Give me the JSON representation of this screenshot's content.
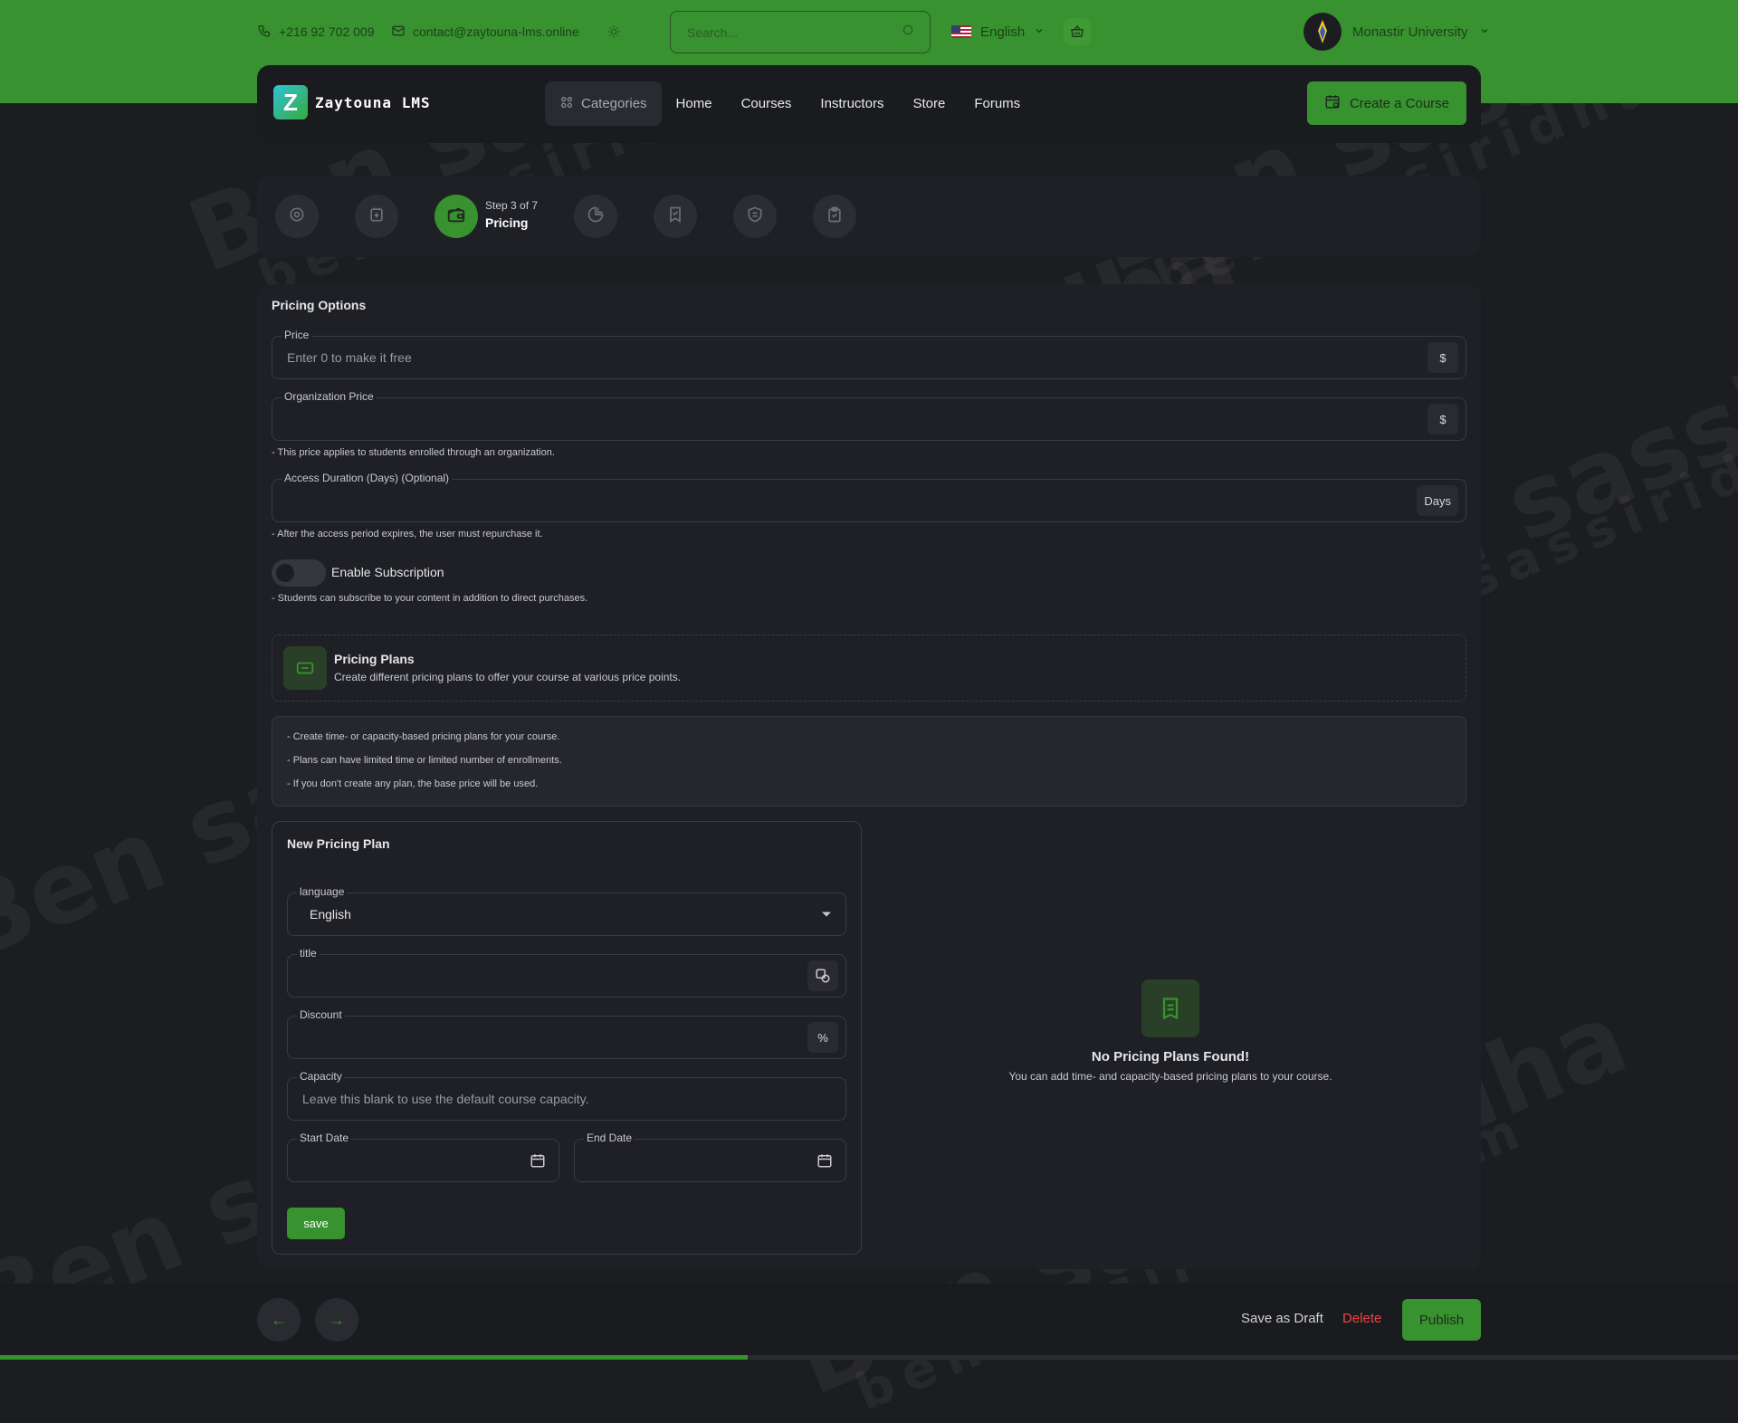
{
  "topbar": {
    "phone": "+216 92 702 009",
    "email": "contact@zaytouna-lms.online",
    "search_placeholder": "Search...",
    "language": "English",
    "user_name": "Monastir University"
  },
  "brand": {
    "logo_letter": "Z",
    "name": "Zaytouna LMS"
  },
  "nav": {
    "categories": "Categories",
    "items": [
      "Home",
      "Courses",
      "Instructors",
      "Store",
      "Forums"
    ],
    "create_button": "Create a Course"
  },
  "steps": {
    "current_label": "Step 3 of 7",
    "current_name": "Pricing",
    "current": 3,
    "total": 7
  },
  "pricing": {
    "section_title": "Pricing Options",
    "price_label": "Price",
    "price_placeholder": "Enter 0 to make it free",
    "price_suffix": "$",
    "org_price_label": "Organization Price",
    "org_price_suffix": "$",
    "org_hint": "- This price applies to students enrolled through an organization.",
    "access_label": "Access Duration (Days) (Optional)",
    "access_suffix": "Days",
    "access_hint": "- After the access period expires, the user must repurchase it.",
    "subscription_label": "Enable Subscription",
    "subscription_enabled": false,
    "subscription_hint": "- Students can subscribe to your content in addition to direct purchases."
  },
  "plans": {
    "title": "Pricing Plans",
    "subtitle": "Create different pricing plans to offer your course at various price points.",
    "info": [
      "- Create time- or capacity-based pricing plans for your course.",
      "- Plans can have limited time or limited number of enrollments.",
      "- If you don't create any plan, the base price will be used."
    ]
  },
  "new_plan": {
    "title": "New Pricing Plan",
    "language_label": "language",
    "language_value": "English",
    "title_label": "title",
    "discount_label": "Discount",
    "discount_suffix": "%",
    "capacity_label": "Capacity",
    "capacity_placeholder": "Leave this blank to use the default course capacity.",
    "start_label": "Start Date",
    "end_label": "End Date",
    "save_button": "save"
  },
  "empty_state": {
    "title": "No Pricing Plans Found!",
    "subtitle": "You can add time- and capacity-based pricing plans to your course."
  },
  "footer": {
    "prev_arrow": "←",
    "next_arrow": "→",
    "save_draft": "Save as Draft",
    "delete": "Delete",
    "publish": "Publish",
    "progress_fraction": 0.43
  },
  "watermark": {
    "big": "Ben sassi Ridha",
    "small": "bensassiridha.com"
  },
  "colors": {
    "accent": "#37922f",
    "background": "#1c1d21",
    "card": "#1f2025",
    "danger": "#ef4444"
  },
  "icons": {
    "phone": "phone-icon",
    "mail": "mail-icon",
    "theme": "sun-icon",
    "search": "search-icon",
    "cart": "basket-icon",
    "chevron": "chevron-down-icon",
    "categories": "grid-icon",
    "create": "calendar-plus-icon",
    "calendar": "calendar-icon"
  }
}
